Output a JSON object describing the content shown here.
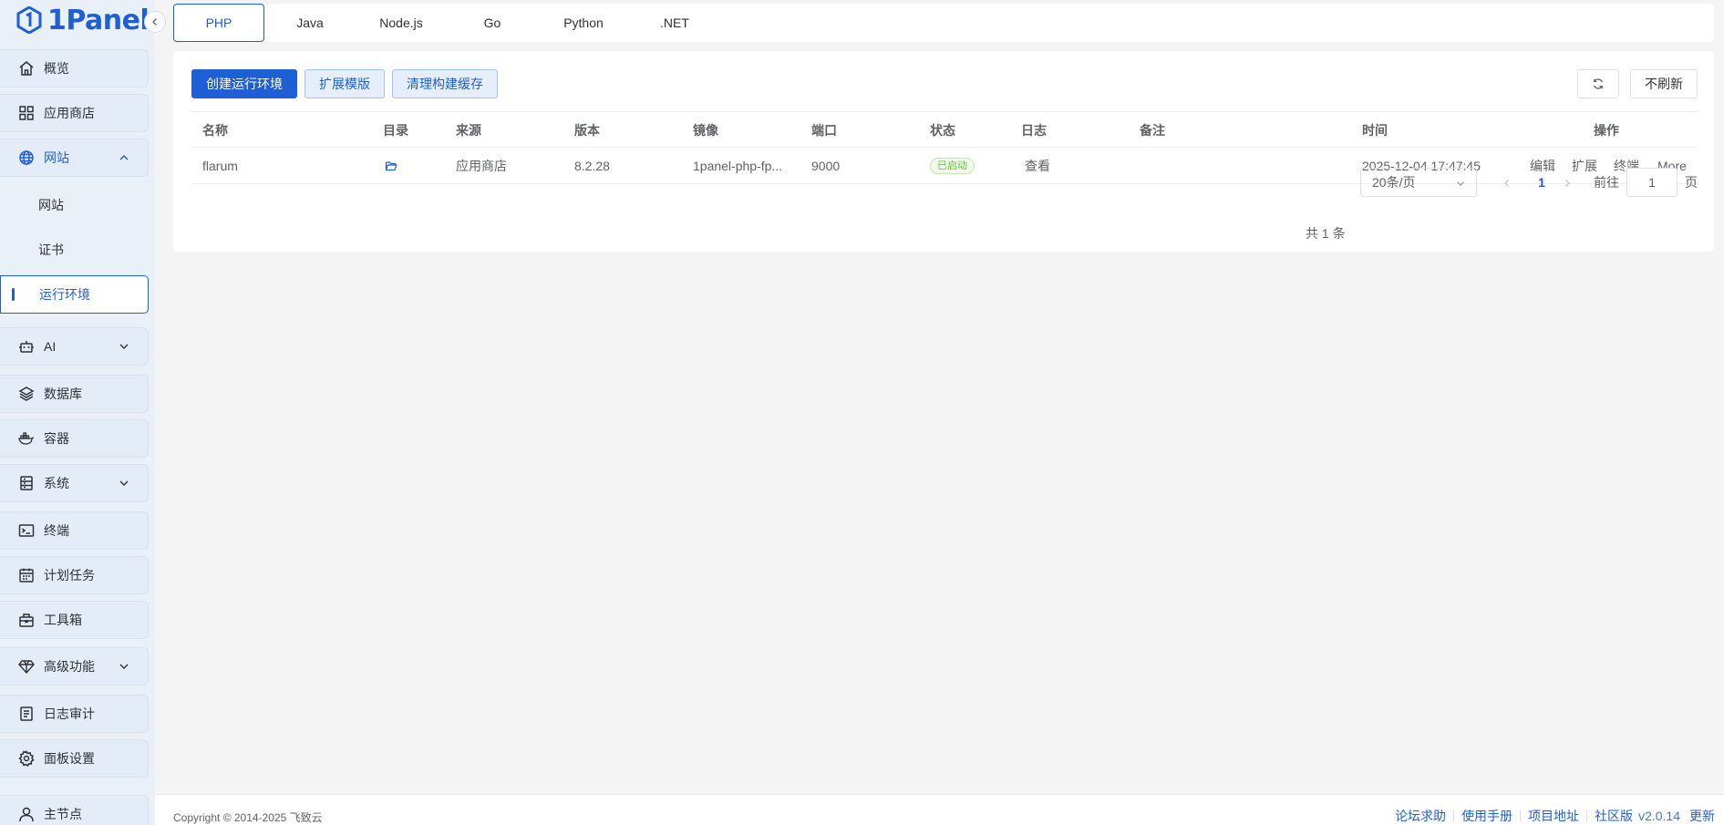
{
  "brand": {
    "name": "1Panel"
  },
  "sidebar": {
    "items": [
      {
        "label": "概览",
        "icon": "home-icon"
      },
      {
        "label": "应用商店",
        "icon": "apps-grid-icon"
      },
      {
        "label": "网站",
        "icon": "globe-icon",
        "expanded": true,
        "children": [
          {
            "label": "网站"
          },
          {
            "label": "证书"
          },
          {
            "label": "运行环境",
            "active": true
          }
        ]
      },
      {
        "label": "AI",
        "icon": "robot-icon",
        "has_children": true
      },
      {
        "label": "数据库",
        "icon": "layers-icon"
      },
      {
        "label": "容器",
        "icon": "docker-icon"
      },
      {
        "label": "系统",
        "icon": "server-icon",
        "has_children": true
      },
      {
        "label": "终端",
        "icon": "terminal-icon"
      },
      {
        "label": "计划任务",
        "icon": "calendar-icon"
      },
      {
        "label": "工具箱",
        "icon": "toolbox-icon"
      },
      {
        "label": "高级功能",
        "icon": "diamond-icon",
        "has_children": true
      },
      {
        "label": "日志审计",
        "icon": "log-icon"
      },
      {
        "label": "面板设置",
        "icon": "gear-icon"
      },
      {
        "label": "主节点",
        "icon": "user-icon"
      }
    ]
  },
  "tabs": [
    {
      "label": "PHP",
      "active": true
    },
    {
      "label": "Java"
    },
    {
      "label": "Node.js"
    },
    {
      "label": "Go"
    },
    {
      "label": "Python"
    },
    {
      "label": ".NET"
    }
  ],
  "toolbar": {
    "create_label": "创建运行环境",
    "extensions_label": "扩展模版",
    "clear_cache_label": "清理构建缓存",
    "refresh_icon": "refresh-icon",
    "auto_refresh_label": "不刷新"
  },
  "table": {
    "columns": {
      "name": "名称",
      "dir": "目录",
      "source": "来源",
      "version": "版本",
      "image": "镜像",
      "port": "端口",
      "status": "状态",
      "log": "日志",
      "remark": "备注",
      "time": "时间",
      "actions": "操作"
    },
    "rows": [
      {
        "name": "flarum",
        "source": "应用商店",
        "version": "8.2.28",
        "image": "1panel-php-fp...",
        "port": "9000",
        "status": "已启动",
        "log": "查看",
        "remark": "",
        "time": "2025-12-04 17:47:45",
        "actions": {
          "edit": "编辑",
          "extend": "扩展",
          "terminal": "终端",
          "more": "More"
        }
      }
    ]
  },
  "pagination": {
    "total": "共 1 条",
    "page_size": "20条/页",
    "current_page": "1",
    "goto_label": "前往",
    "goto_value": "1",
    "page_suffix": "页"
  },
  "footer": {
    "copyright": "Copyright © 2014-2025 飞致云",
    "links": {
      "forum": "论坛求助",
      "manual": "使用手册",
      "project": "项目地址",
      "edition": "社区版"
    },
    "version": "v2.0.14",
    "update": "更新"
  },
  "colors": {
    "primary": "#1f5fd6",
    "sidebar_bg": "#eaf0f8",
    "success": "#67c23a"
  }
}
